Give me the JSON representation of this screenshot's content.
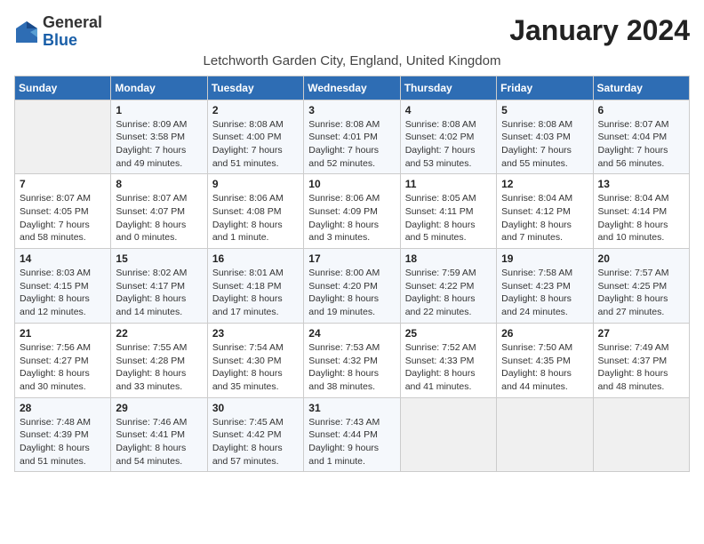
{
  "header": {
    "logo_general": "General",
    "logo_blue": "Blue",
    "month_title": "January 2024",
    "location": "Letchworth Garden City, England, United Kingdom"
  },
  "days_of_week": [
    "Sunday",
    "Monday",
    "Tuesday",
    "Wednesday",
    "Thursday",
    "Friday",
    "Saturday"
  ],
  "weeks": [
    [
      {
        "day": "",
        "info": ""
      },
      {
        "day": "1",
        "info": "Sunrise: 8:09 AM\nSunset: 3:58 PM\nDaylight: 7 hours\nand 49 minutes."
      },
      {
        "day": "2",
        "info": "Sunrise: 8:08 AM\nSunset: 4:00 PM\nDaylight: 7 hours\nand 51 minutes."
      },
      {
        "day": "3",
        "info": "Sunrise: 8:08 AM\nSunset: 4:01 PM\nDaylight: 7 hours\nand 52 minutes."
      },
      {
        "day": "4",
        "info": "Sunrise: 8:08 AM\nSunset: 4:02 PM\nDaylight: 7 hours\nand 53 minutes."
      },
      {
        "day": "5",
        "info": "Sunrise: 8:08 AM\nSunset: 4:03 PM\nDaylight: 7 hours\nand 55 minutes."
      },
      {
        "day": "6",
        "info": "Sunrise: 8:07 AM\nSunset: 4:04 PM\nDaylight: 7 hours\nand 56 minutes."
      }
    ],
    [
      {
        "day": "7",
        "info": "Sunrise: 8:07 AM\nSunset: 4:05 PM\nDaylight: 7 hours\nand 58 minutes."
      },
      {
        "day": "8",
        "info": "Sunrise: 8:07 AM\nSunset: 4:07 PM\nDaylight: 8 hours\nand 0 minutes."
      },
      {
        "day": "9",
        "info": "Sunrise: 8:06 AM\nSunset: 4:08 PM\nDaylight: 8 hours\nand 1 minute."
      },
      {
        "day": "10",
        "info": "Sunrise: 8:06 AM\nSunset: 4:09 PM\nDaylight: 8 hours\nand 3 minutes."
      },
      {
        "day": "11",
        "info": "Sunrise: 8:05 AM\nSunset: 4:11 PM\nDaylight: 8 hours\nand 5 minutes."
      },
      {
        "day": "12",
        "info": "Sunrise: 8:04 AM\nSunset: 4:12 PM\nDaylight: 8 hours\nand 7 minutes."
      },
      {
        "day": "13",
        "info": "Sunrise: 8:04 AM\nSunset: 4:14 PM\nDaylight: 8 hours\nand 10 minutes."
      }
    ],
    [
      {
        "day": "14",
        "info": "Sunrise: 8:03 AM\nSunset: 4:15 PM\nDaylight: 8 hours\nand 12 minutes."
      },
      {
        "day": "15",
        "info": "Sunrise: 8:02 AM\nSunset: 4:17 PM\nDaylight: 8 hours\nand 14 minutes."
      },
      {
        "day": "16",
        "info": "Sunrise: 8:01 AM\nSunset: 4:18 PM\nDaylight: 8 hours\nand 17 minutes."
      },
      {
        "day": "17",
        "info": "Sunrise: 8:00 AM\nSunset: 4:20 PM\nDaylight: 8 hours\nand 19 minutes."
      },
      {
        "day": "18",
        "info": "Sunrise: 7:59 AM\nSunset: 4:22 PM\nDaylight: 8 hours\nand 22 minutes."
      },
      {
        "day": "19",
        "info": "Sunrise: 7:58 AM\nSunset: 4:23 PM\nDaylight: 8 hours\nand 24 minutes."
      },
      {
        "day": "20",
        "info": "Sunrise: 7:57 AM\nSunset: 4:25 PM\nDaylight: 8 hours\nand 27 minutes."
      }
    ],
    [
      {
        "day": "21",
        "info": "Sunrise: 7:56 AM\nSunset: 4:27 PM\nDaylight: 8 hours\nand 30 minutes."
      },
      {
        "day": "22",
        "info": "Sunrise: 7:55 AM\nSunset: 4:28 PM\nDaylight: 8 hours\nand 33 minutes."
      },
      {
        "day": "23",
        "info": "Sunrise: 7:54 AM\nSunset: 4:30 PM\nDaylight: 8 hours\nand 35 minutes."
      },
      {
        "day": "24",
        "info": "Sunrise: 7:53 AM\nSunset: 4:32 PM\nDaylight: 8 hours\nand 38 minutes."
      },
      {
        "day": "25",
        "info": "Sunrise: 7:52 AM\nSunset: 4:33 PM\nDaylight: 8 hours\nand 41 minutes."
      },
      {
        "day": "26",
        "info": "Sunrise: 7:50 AM\nSunset: 4:35 PM\nDaylight: 8 hours\nand 44 minutes."
      },
      {
        "day": "27",
        "info": "Sunrise: 7:49 AM\nSunset: 4:37 PM\nDaylight: 8 hours\nand 48 minutes."
      }
    ],
    [
      {
        "day": "28",
        "info": "Sunrise: 7:48 AM\nSunset: 4:39 PM\nDaylight: 8 hours\nand 51 minutes."
      },
      {
        "day": "29",
        "info": "Sunrise: 7:46 AM\nSunset: 4:41 PM\nDaylight: 8 hours\nand 54 minutes."
      },
      {
        "day": "30",
        "info": "Sunrise: 7:45 AM\nSunset: 4:42 PM\nDaylight: 8 hours\nand 57 minutes."
      },
      {
        "day": "31",
        "info": "Sunrise: 7:43 AM\nSunset: 4:44 PM\nDaylight: 9 hours\nand 1 minute."
      },
      {
        "day": "",
        "info": ""
      },
      {
        "day": "",
        "info": ""
      },
      {
        "day": "",
        "info": ""
      }
    ]
  ]
}
